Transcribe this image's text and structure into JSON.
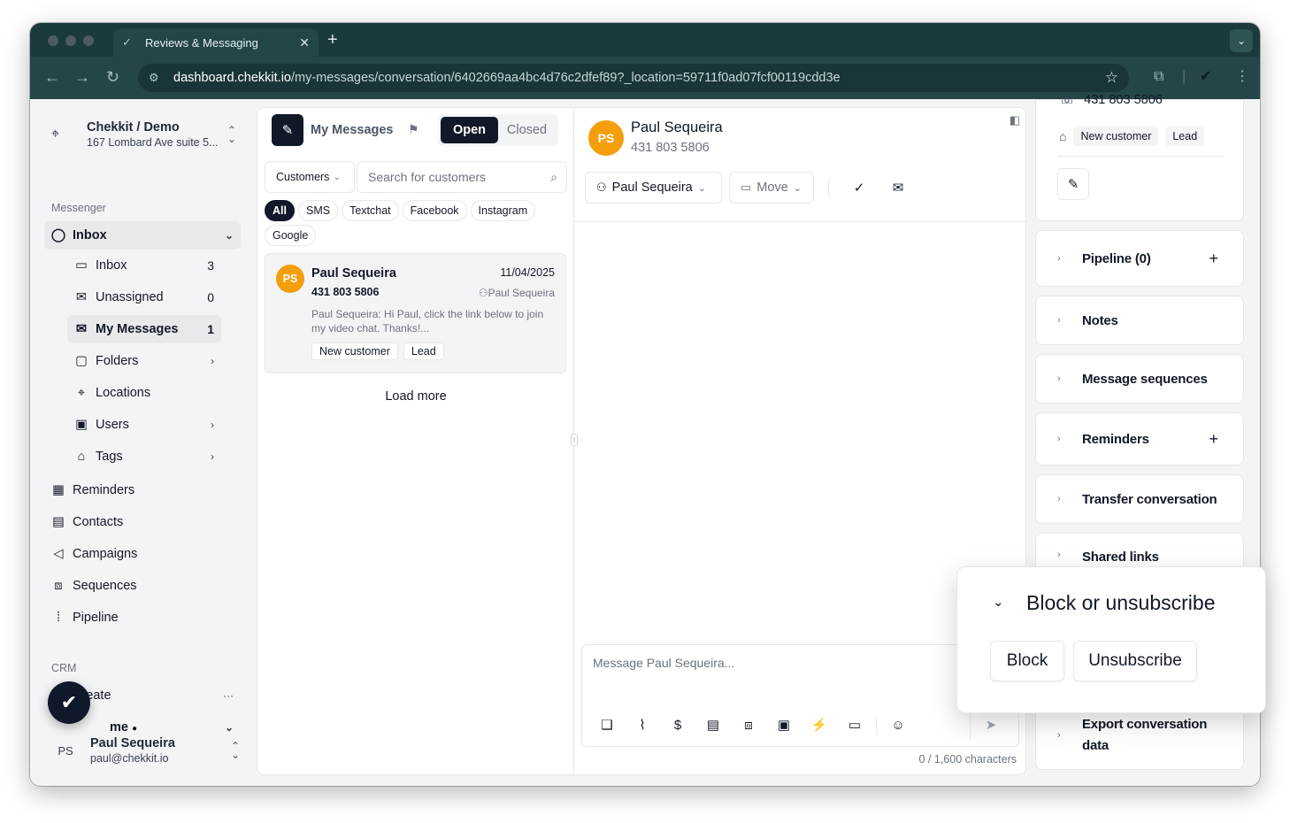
{
  "browser": {
    "tab_title": "Reviews & Messaging",
    "url_host": "dashboard.chekkit.io",
    "url_path": "/my-messages/conversation/6402669aa4bc4d76c2dfef89?_location=59711f0ad07fcf00119cdd3e"
  },
  "sidebar": {
    "org_name": "Chekkit / Demo",
    "org_address": "167 Lombard Ave suite 5...",
    "messenger_label": "Messenger",
    "inbox_group": "Inbox",
    "items": [
      {
        "label": "Inbox",
        "count": "3"
      },
      {
        "label": "Unassigned",
        "count": "0"
      },
      {
        "label": "My Messages",
        "count": "1"
      },
      {
        "label": "Folders"
      },
      {
        "label": "Locations"
      },
      {
        "label": "Users"
      },
      {
        "label": "Tags"
      }
    ],
    "top_items": [
      {
        "label": "Reminders"
      },
      {
        "label": "Contacts"
      },
      {
        "label": "Campaigns"
      },
      {
        "label": "Sequences"
      },
      {
        "label": "Pipeline"
      }
    ],
    "crm_label": "CRM",
    "create_label": "Create",
    "home_label": "me",
    "user": {
      "initials": "PS",
      "name": "Paul Sequeira",
      "email": "paul@chekkit.io"
    }
  },
  "list": {
    "title": "My Messages",
    "segments": [
      "Open",
      "Closed"
    ],
    "filter_label": "Customers",
    "search_placeholder": "Search for customers",
    "channels": [
      "All",
      "SMS",
      "Textchat",
      "Facebook",
      "Instagram",
      "Google"
    ],
    "conversations": [
      {
        "initials": "PS",
        "name": "Paul Sequeira",
        "date": "11/04/2025",
        "phone": "431 803 5806",
        "assignee": "Paul Sequeira",
        "preview": "Paul Sequeira: Hi Paul, click the link below to join my video chat. Thanks!...",
        "tags": [
          "New customer",
          "Lead"
        ]
      }
    ],
    "load_more": "Load more"
  },
  "conversation": {
    "initials": "PS",
    "name": "Paul Sequeira",
    "phone": "431 803 5806",
    "assign_label": "Paul Sequeira",
    "move_label": "Move",
    "composer_placeholder": "Message Paul Sequeira...",
    "char_count": "0 / 1,600 characters"
  },
  "details": {
    "phone": "431 803 5806",
    "tags": [
      "New customer",
      "Lead"
    ],
    "sections": [
      {
        "label": "Pipeline (0)"
      },
      {
        "label": "Notes"
      },
      {
        "label": "Message sequences"
      },
      {
        "label": "Reminders"
      },
      {
        "label": "Transfer conversation"
      },
      {
        "label": "Shared links"
      },
      {
        "label": "Export conversation data"
      }
    ]
  },
  "popover": {
    "title": "Block or unsubscribe",
    "block_label": "Block",
    "unsubscribe_label": "Unsubscribe"
  }
}
